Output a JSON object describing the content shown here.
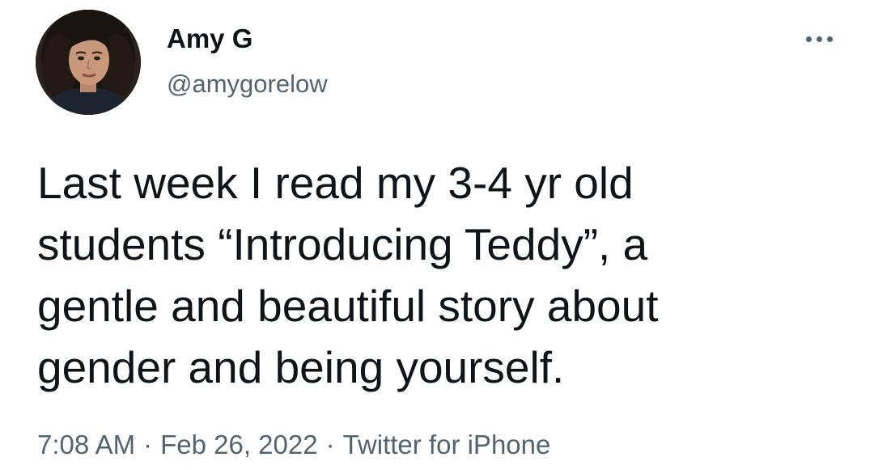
{
  "tweet": {
    "author": {
      "display_name": "Amy G",
      "handle": "@amygorelow",
      "avatar": "profile-photo"
    },
    "more_icon": "more-horizontal-icon",
    "text_lines": [
      "Last week I read my 3-4 yr old",
      "students “Introducing Teddy”, a",
      "gentle and beautiful story about",
      "gender and being yourself."
    ],
    "time": "7:08 AM",
    "separator": "·",
    "date": "Feb 26, 2022",
    "source": "Twitter for iPhone"
  },
  "colors": {
    "text_primary": "#0f1419",
    "text_secondary": "#536471",
    "background": "#ffffff"
  }
}
